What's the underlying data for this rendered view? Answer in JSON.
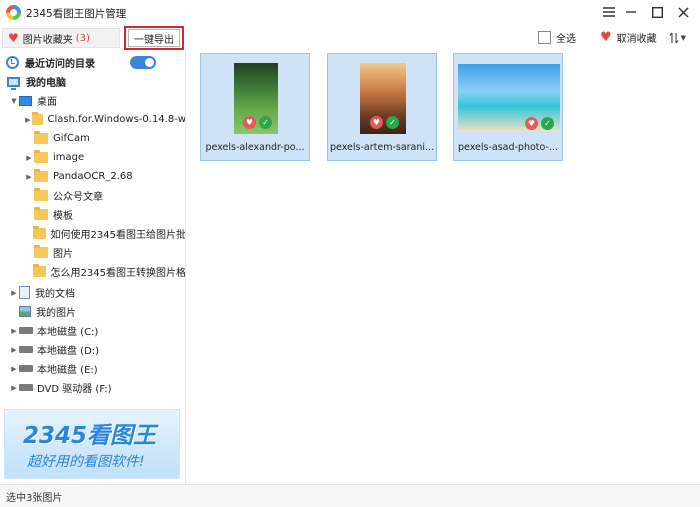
{
  "app": {
    "title": "2345看图王图片管理"
  },
  "toolbar": {
    "favorites_label": "图片收藏夹",
    "favorites_count": "(3)",
    "export_label": "一键导出",
    "select_all_label": "全选",
    "unfavorite_label": "取消收藏",
    "accent_color": "#d9262c"
  },
  "sidebar": {
    "recent_label": "最近访问的目录",
    "recent_toggle_on": true,
    "my_computer_label": "我的电脑",
    "desktop_label": "桌面",
    "desktop_items": [
      {
        "label": "Clash.for.Windows-0.14.8-w",
        "expandable": true
      },
      {
        "label": "GifCam",
        "expandable": false
      },
      {
        "label": "image",
        "expandable": true
      },
      {
        "label": "PandaOCR_2.68",
        "expandable": true
      },
      {
        "label": "公众号文章",
        "expandable": false
      },
      {
        "label": "模板",
        "expandable": false
      },
      {
        "label": "如何使用2345看图王给图片批",
        "expandable": false
      },
      {
        "label": "图片",
        "expandable": false
      },
      {
        "label": "怎么用2345看图王转换图片格",
        "expandable": false
      }
    ],
    "my_documents_label": "我的文档",
    "my_pictures_label": "我的图片",
    "drives": [
      {
        "label": "本地磁盘 (C:)"
      },
      {
        "label": "本地磁盘 (D:)"
      },
      {
        "label": "本地磁盘 (E:)"
      },
      {
        "label": "DVD 驱动器 (F:)"
      }
    ],
    "ad": {
      "logo": "2345看图王",
      "slogan": "超好用的看图软件!"
    }
  },
  "gallery": {
    "items": [
      {
        "caption": "pexels-alexandr-po...",
        "favorited": true,
        "selected": true
      },
      {
        "caption": "pexels-artem-sarani...",
        "favorited": true,
        "selected": true
      },
      {
        "caption": "pexels-asad-photo-...",
        "favorited": true,
        "selected": true
      }
    ]
  },
  "status": {
    "text": "选中3张图片"
  }
}
